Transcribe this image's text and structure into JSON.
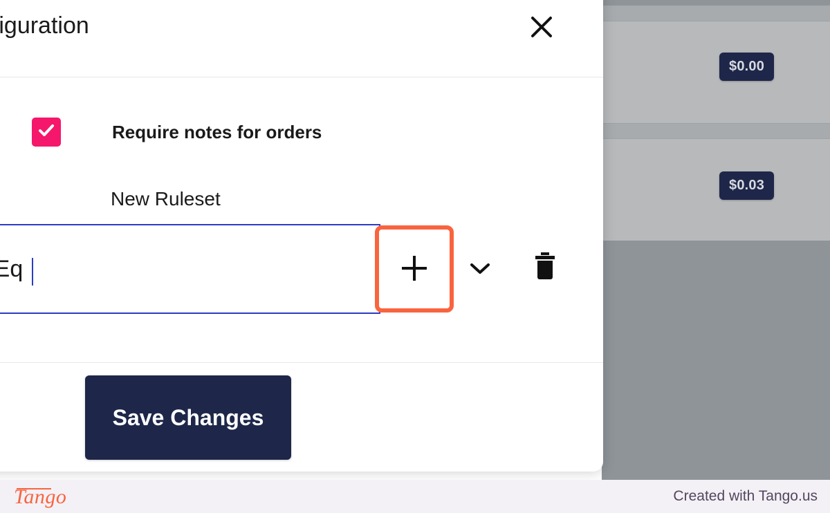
{
  "modal": {
    "title": "nfiguration",
    "close_icon": "close-icon",
    "checkbox": {
      "label": "Require notes for orders",
      "checked": true,
      "color": "#f5176b"
    },
    "field": {
      "label": "New Ruleset",
      "value": "ZeEq",
      "placeholder": "",
      "border_color": "#2b3cc4"
    },
    "actions": {
      "add_icon": "plus-icon",
      "expand_icon": "chevron-down-icon",
      "delete_icon": "trash-icon",
      "highlight_color": "#f9643f"
    },
    "save_button": {
      "label": "Save Changes",
      "color": "#1e2749"
    }
  },
  "background": {
    "rows": [
      {
        "price": "$0.00"
      },
      {
        "price": "$0.03"
      }
    ],
    "badge_color": "#1e2749"
  },
  "footer": {
    "logo": "Tango",
    "credit": "Created with Tango.us",
    "logo_color": "#f9643f"
  }
}
